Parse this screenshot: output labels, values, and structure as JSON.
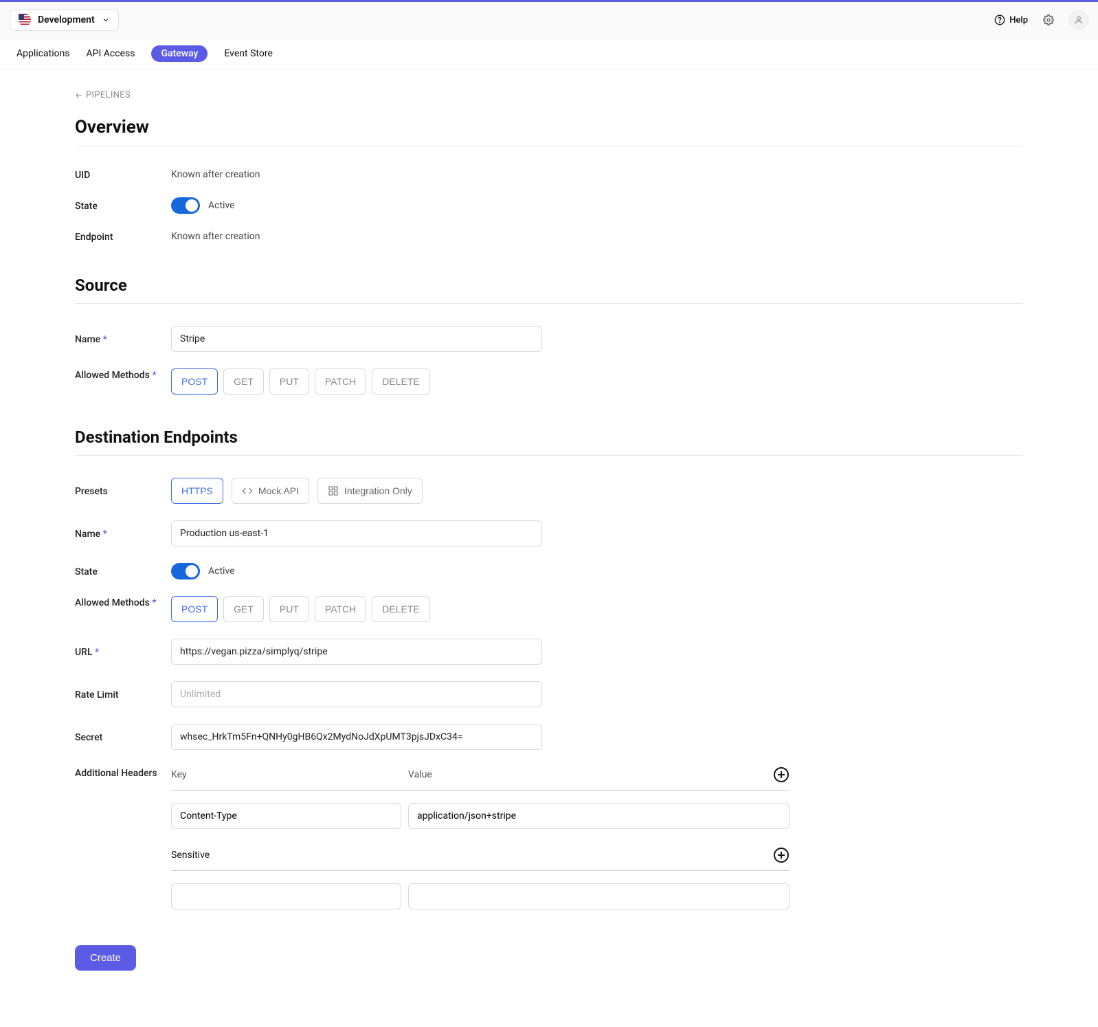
{
  "topbar": {
    "environment": "Development",
    "help_label": "Help"
  },
  "nav": {
    "applications": "Applications",
    "api_access": "API Access",
    "gateway": "Gateway",
    "event_store": "Event Store"
  },
  "breadcrumb": {
    "back_label": "PIPELINES"
  },
  "overview": {
    "heading": "Overview",
    "uid_label": "UID",
    "uid_value": "Known after creation",
    "state_label": "State",
    "state_value": "Active",
    "endpoint_label": "Endpoint",
    "endpoint_value": "Known after creation"
  },
  "source": {
    "heading": "Source",
    "name_label": "Name",
    "name_value": "Stripe",
    "methods_label": "Allowed Methods",
    "methods": [
      "POST",
      "GET",
      "PUT",
      "PATCH",
      "DELETE"
    ],
    "active_method": "POST"
  },
  "destination": {
    "heading": "Destination Endpoints",
    "presets_label": "Presets",
    "presets": {
      "https": "HTTPS",
      "mock": "Mock API",
      "integration": "Integration Only"
    },
    "name_label": "Name",
    "name_value": "Production us-east-1",
    "state_label": "State",
    "state_value": "Active",
    "methods_label": "Allowed Methods",
    "methods": [
      "POST",
      "GET",
      "PUT",
      "PATCH",
      "DELETE"
    ],
    "active_method": "POST",
    "url_label": "URL",
    "url_value": "https://vegan.pizza/simplyq/stripe",
    "rate_limit_label": "Rate Limit",
    "rate_limit_placeholder": "Unlimited",
    "secret_label": "Secret",
    "secret_value": "whsec_HrkTm5Fn+QNHy0gHB6Qx2MydNoJdXpUMT3pjsJDxC34=",
    "headers_label": "Additional Headers",
    "headers_key_col": "Key",
    "headers_value_col": "Value",
    "headers": [
      {
        "key": "Content-Type",
        "value": "application/json+stripe"
      }
    ],
    "sensitive_label": "Sensitive"
  },
  "actions": {
    "create": "Create"
  }
}
